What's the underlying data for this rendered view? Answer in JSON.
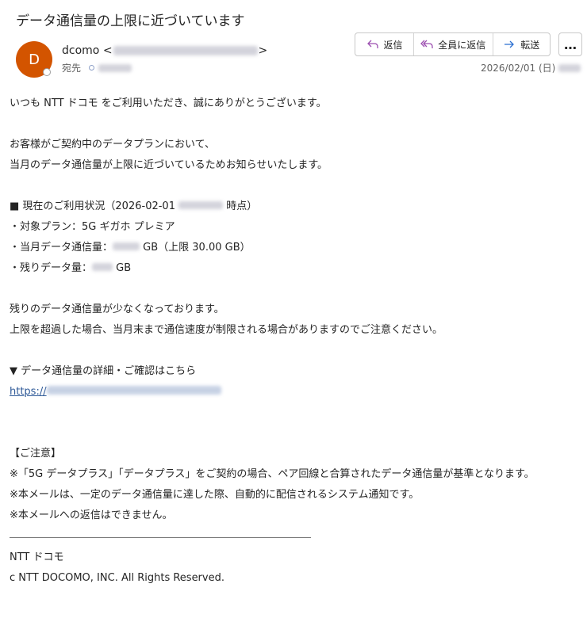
{
  "subject": "データ通信量の上限に近づいています",
  "sender": {
    "initial": "D",
    "name": "dcomo",
    "open": "<",
    "close": ">"
  },
  "to_label": "宛先",
  "actions": {
    "reply": "返信",
    "reply_all": "全員に返信",
    "forward": "転送",
    "more": "…"
  },
  "date": "2026/02/01 (日)",
  "body": {
    "greeting": "いつも NTT ドコモ をご利用いただき、誠にありがとうございます。",
    "p1_l1": "お客様がご契約中のデータプランにおいて、",
    "p1_l2": "当月のデータ通信量が上限に近づいているためお知らせいたします。",
    "status_head_a": "■  現在のご利用状況（2026-02-01 ",
    "status_head_b": " 時点）",
    "plan": "・対象プラン：5G ギガホ プレミア",
    "usage_a": "・当月データ通信量：",
    "usage_b": " GB（上限 30.00 GB）",
    "remain_a": "・残りデータ量：",
    "remain_b": " GB",
    "p2_l1": "残りのデータ通信量が少なくなっております。",
    "p2_l2": "上限を超過した場合、当月末まで通信速度が制限される場合がありますのでご注意ください。",
    "detail_head": "▼  データ通信量の詳細・ご確認はこちら",
    "link_prefix": "https://",
    "notice_head": "【ご注意】",
    "notice_1": "※「5G データプラス」「データプラス」をご契約の場合、ペア回線と合算されたデータ通信量が基準となります。",
    "notice_2": "※本メールは、一定のデータ通信量に達した際、自動的に配信されるシステム通知です。",
    "notice_3": "※本メールへの返信はできません。",
    "footer_company": "NTT ドコモ",
    "footer_copyright": "c NTT DOCOMO, INC. All Rights Reserved."
  },
  "colors": {
    "avatar": "#d35400",
    "link": "#2f5a98",
    "reply_icon": "#9c4fb0",
    "forward_icon": "#2b6fd1"
  }
}
